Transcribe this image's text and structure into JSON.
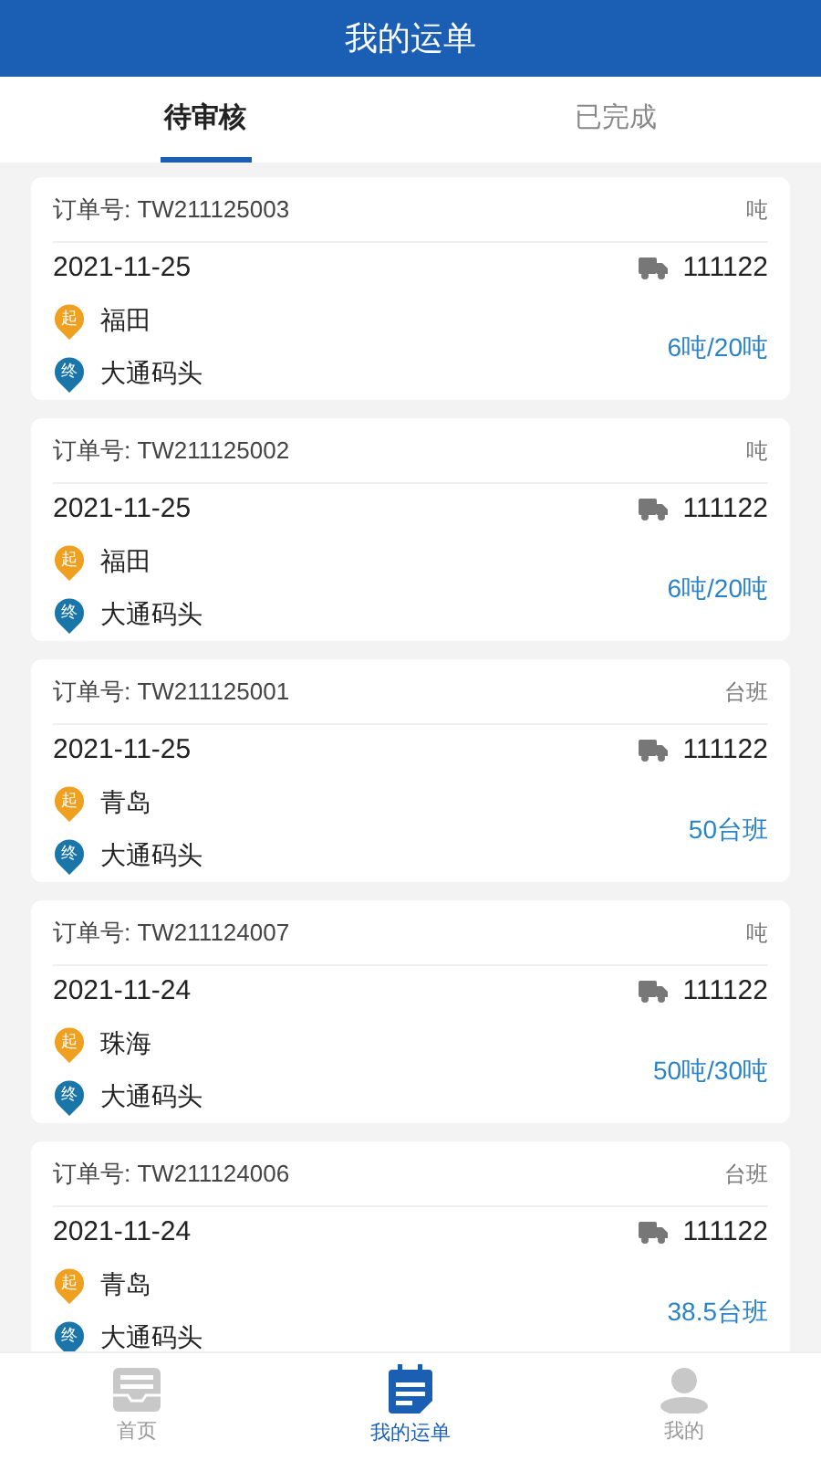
{
  "header": {
    "title": "我的运单"
  },
  "tabs": [
    {
      "label": "待审核",
      "selected": true
    },
    {
      "label": "已完成",
      "selected": false
    }
  ],
  "orders": [
    {
      "order_label": "订单号: TW211125003",
      "unit": "吨",
      "date": "2021-11-25",
      "plate": "111122",
      "start_mark": "起",
      "origin": "福田",
      "end_mark": "终",
      "destination": "大通码头",
      "amount": "6吨/20吨"
    },
    {
      "order_label": "订单号: TW211125002",
      "unit": "吨",
      "date": "2021-11-25",
      "plate": "111122",
      "start_mark": "起",
      "origin": "福田",
      "end_mark": "终",
      "destination": "大通码头",
      "amount": "6吨/20吨"
    },
    {
      "order_label": "订单号: TW211125001",
      "unit": "台班",
      "date": "2021-11-25",
      "plate": "111122",
      "start_mark": "起",
      "origin": "青岛",
      "end_mark": "终",
      "destination": "大通码头",
      "amount": "50台班"
    },
    {
      "order_label": "订单号: TW211124007",
      "unit": "吨",
      "date": "2021-11-24",
      "plate": "111122",
      "start_mark": "起",
      "origin": "珠海",
      "end_mark": "终",
      "destination": "大通码头",
      "amount": "50吨/30吨"
    },
    {
      "order_label": "订单号: TW211124006",
      "unit": "台班",
      "date": "2021-11-24",
      "plate": "111122",
      "start_mark": "起",
      "origin": "青岛",
      "end_mark": "终",
      "destination": "大通码头",
      "amount": "38.5台班"
    }
  ],
  "nav": [
    {
      "kind": "inbox",
      "label": "首页",
      "selected": false
    },
    {
      "kind": "orders",
      "label": "我的运单",
      "selected": true
    },
    {
      "kind": "person",
      "label": "我的",
      "selected": false
    }
  ]
}
